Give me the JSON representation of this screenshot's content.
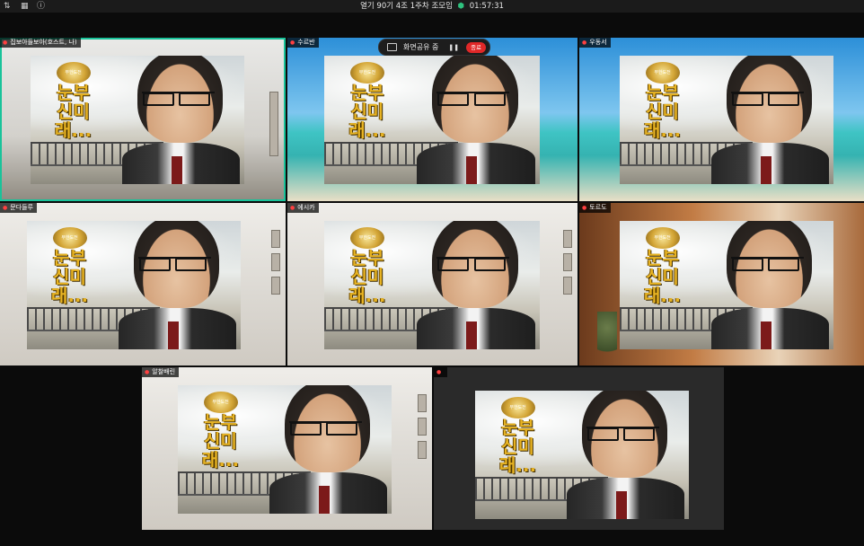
{
  "window": {
    "title": "열기 90기 4조 1주차 조모임",
    "timer": "01:57:31",
    "colors": {
      "accent_speaker": "#19c39a",
      "mic_muted": "#ff4040",
      "stop_button": "#e02828",
      "secure_shield": "#2ec27e"
    }
  },
  "share": {
    "label": "화면공유 중",
    "stop_label": "종료"
  },
  "shared_content": {
    "badge_text": "무한도전",
    "title_text": "눈부신미래..."
  },
  "participants": [
    {
      "name": "집보아들보아(호스트, 나)",
      "background": "office"
    },
    {
      "name": "수르반",
      "background": "beach"
    },
    {
      "name": "우동서",
      "background": "beach"
    },
    {
      "name": "문다들루",
      "background": "room"
    },
    {
      "name": "에시카",
      "background": "room"
    },
    {
      "name": "토르도",
      "background": "warm"
    },
    {
      "name": "알찰배린",
      "background": "room"
    },
    {
      "name": "",
      "background": "gray"
    }
  ],
  "icons": [
    "sort-icon",
    "grid-view-icon",
    "info-icon",
    "shield-icon",
    "mic-muted-icon",
    "screen-share-icon",
    "pause-icon"
  ]
}
